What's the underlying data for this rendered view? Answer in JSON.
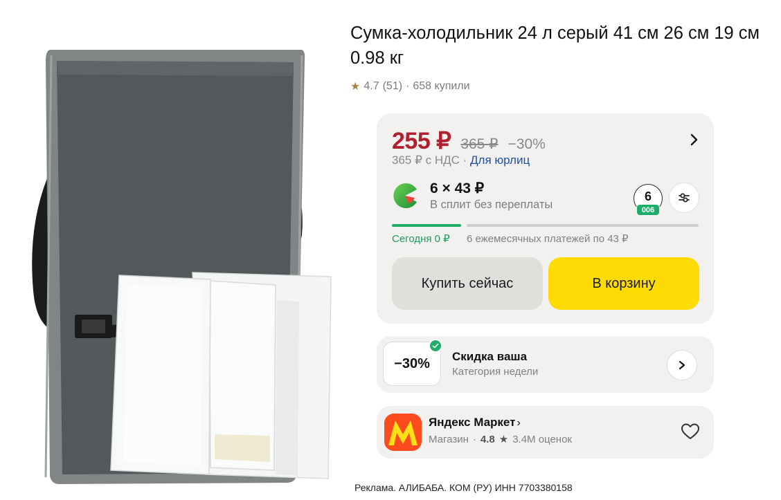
{
  "product": {
    "title": "Сумка-холодильник 24 л серый 41 см 26 см 19 см 0.98 кг",
    "rating": "4.7",
    "reviews": "(51)",
    "separator": "·",
    "purchased": "658 купили",
    "image_icon": "cooler-bag-image"
  },
  "price": {
    "current": "255 ₽",
    "old": "365 ₽",
    "discount": "−30%",
    "vat_text": "365 ₽ с НДС ·",
    "vat_link": "Для юрлиц"
  },
  "split": {
    "amount": "6 × 43 ₽",
    "subtitle": "В сплит без переплаты",
    "months": "6",
    "badge": "006",
    "today": "Сегодня 0 ₽",
    "monthly": "6 ежемесячных платежей по 43 ₽"
  },
  "actions": {
    "buy_now": "Купить сейчас",
    "add_to_cart": "В корзину"
  },
  "promo": {
    "badge": "−30%",
    "title": "Скидка ваша",
    "subtitle": "Категория недели"
  },
  "shop": {
    "name": "Яндекс Маркет",
    "chevron": "›",
    "type": "Магазин",
    "dot": "·",
    "rating": "4.8",
    "star": "★",
    "reviews": "3.4M оценок"
  },
  "ad": {
    "text": "Реклама. АЛИБАБА. КОМ (РУ) ИНН 7703380158"
  },
  "colors": {
    "price_red": "#b1202d",
    "accent_yellow": "#ffdb05",
    "split_green": "#1eae69",
    "link_blue": "#1f4fa5",
    "card_bg": "#f2f1f0",
    "shop_logo_bg": "#fc4c1d"
  }
}
